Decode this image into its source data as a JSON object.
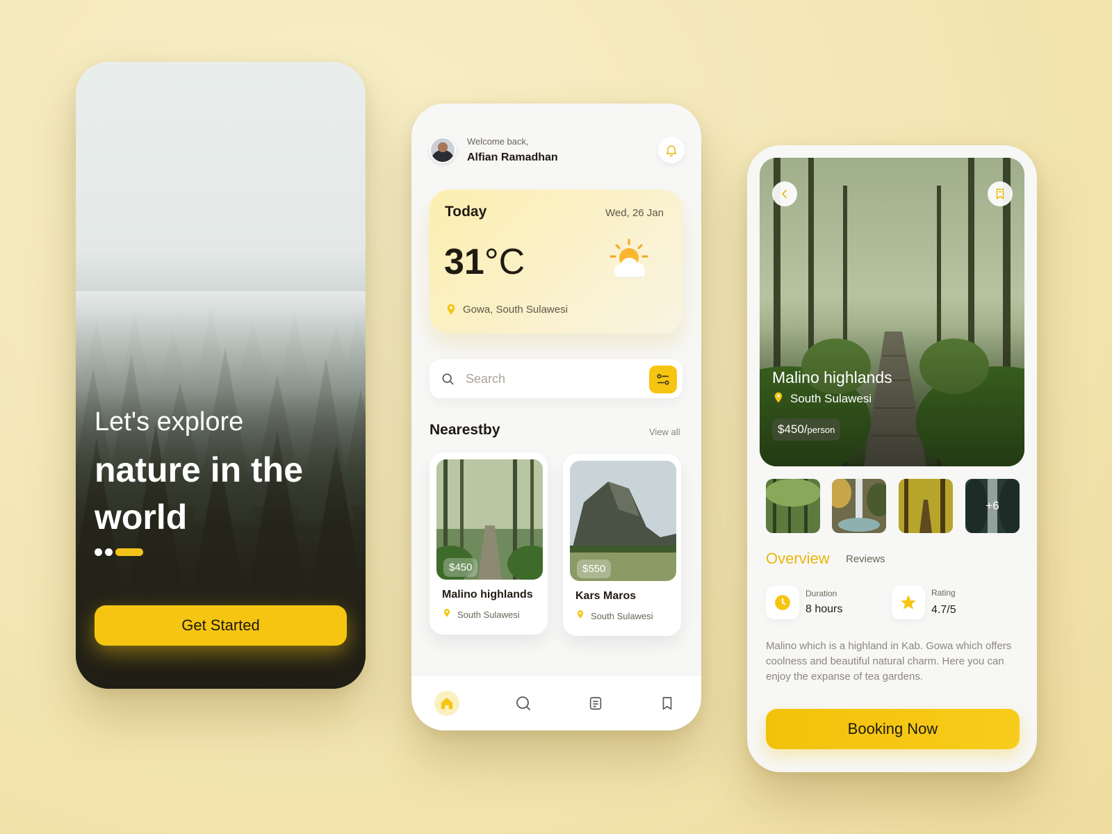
{
  "colors": {
    "accent": "#f6c511",
    "accent_text": "#e9b80e",
    "background": "#f3e6b4",
    "card": "#ffffff",
    "text_dark": "#1f1b12",
    "text_muted": "#8c877c"
  },
  "onboarding": {
    "title_line1": "Let's explore",
    "title_line2": "nature in the world",
    "page_indicator": {
      "count": 3,
      "active_index": 2
    },
    "button_label": "Get Started"
  },
  "home": {
    "header": {
      "greeting": "Welcome back,",
      "user_name": "Alfian Ramadhan",
      "notification_icon": "bell-icon"
    },
    "weather": {
      "label": "Today",
      "date": "Wed, 26 Jan",
      "temperature": "31",
      "unit": "°C",
      "location": "Gowa, South Sulawesi",
      "icon": "partly-sunny-icon"
    },
    "search": {
      "placeholder": "Search",
      "value": "",
      "filter_icon": "filter-icon"
    },
    "nearest": {
      "title": "Nearestby",
      "view_all_label": "View all",
      "places": [
        {
          "name": "Malino highlands",
          "location": "South Sulawesi",
          "price": "$450"
        },
        {
          "name": "Kars Maros",
          "location": "South Sulawesi",
          "price": "$550"
        }
      ]
    },
    "bottom_nav": [
      {
        "icon": "home-icon",
        "active": true
      },
      {
        "icon": "search-icon",
        "active": false
      },
      {
        "icon": "document-icon",
        "active": false
      },
      {
        "icon": "bookmark-icon",
        "active": false
      }
    ]
  },
  "detail": {
    "title": "Malino highlands",
    "location": "South Sulawesi",
    "price": "$450/",
    "price_unit": "person",
    "gallery_more": "+6",
    "tabs": {
      "overview": "Overview",
      "reviews": "Reviews"
    },
    "stats": {
      "duration_label": "Duration",
      "duration_value": "8 hours",
      "rating_label": "Rating",
      "rating_value": "4.7/5"
    },
    "description": "Malino which is a highland in Kab. Gowa which offers coolness and beautiful natural charm. Here you can enjoy the expanse of tea gardens.",
    "button_label": "Booking Now"
  }
}
